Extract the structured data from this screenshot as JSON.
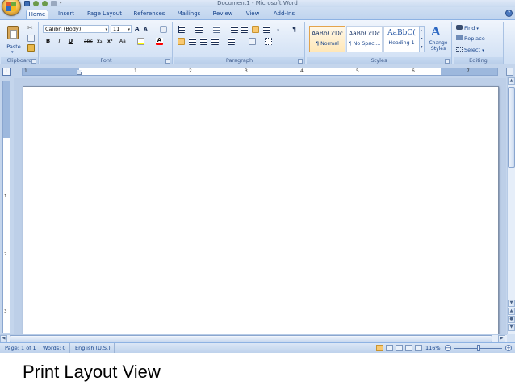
{
  "window": {
    "title": "Document1 - Microsoft Word"
  },
  "tabs": [
    {
      "label": "Home",
      "active": true
    },
    {
      "label": "Insert"
    },
    {
      "label": "Page Layout"
    },
    {
      "label": "References"
    },
    {
      "label": "Mailings"
    },
    {
      "label": "Review"
    },
    {
      "label": "View"
    },
    {
      "label": "Add-Ins"
    }
  ],
  "ribbon": {
    "clipboard": {
      "label": "Clipboard",
      "paste": "Paste"
    },
    "font": {
      "label": "Font",
      "font_name": "Calibri (Body)",
      "font_size": "11"
    },
    "paragraph": {
      "label": "Paragraph"
    },
    "styles": {
      "label": "Styles",
      "items": [
        {
          "sample": "AaBbCcDc",
          "name": "¶ Normal",
          "selected": true
        },
        {
          "sample": "AaBbCcDc",
          "name": "¶ No Spaci..."
        },
        {
          "sample": "AaBbC(",
          "name": "Heading 1"
        }
      ],
      "change_styles": "Change Styles"
    },
    "editing": {
      "label": "Editing",
      "find": "Find",
      "replace": "Replace",
      "select": "Select"
    }
  },
  "ruler": {
    "numbers": [
      "1",
      "1",
      "2",
      "3",
      "4",
      "5",
      "6",
      "7"
    ],
    "vertical_numbers": [
      "1",
      "2",
      "3"
    ]
  },
  "status": {
    "page": "Page: 1 of 1",
    "words": "Words: 0",
    "language": "English (U.S.)",
    "zoom": "116%",
    "zoom_minus": "−",
    "zoom_plus": "+"
  },
  "caption": "Print Layout View",
  "colors": {
    "ribbon_bg": "#dbe7f7",
    "accent_orange": "#f8c870",
    "text_blue": "#15428b"
  }
}
